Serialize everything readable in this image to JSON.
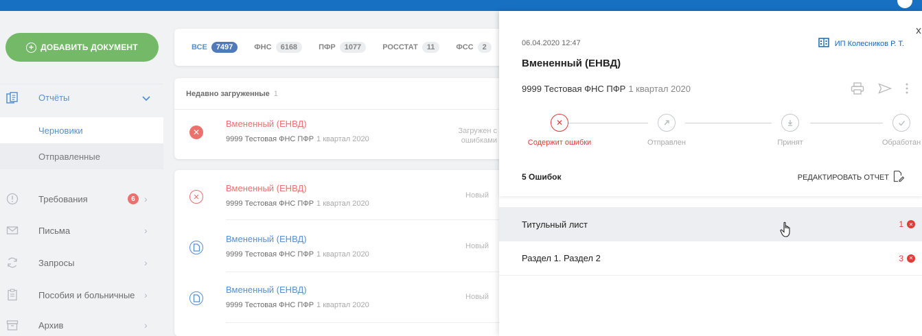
{
  "sidebar": {
    "add_button": "ДОБАВИТЬ ДОКУМЕНТ",
    "reports": "Отчёты",
    "drafts": "Черновики",
    "sent": "Отправленные",
    "items": [
      {
        "label": "Требования",
        "badge": "6",
        "icon": "alert-circle-icon"
      },
      {
        "label": "Письма",
        "icon": "envelope-icon"
      },
      {
        "label": "Запросы",
        "icon": "refresh-icon"
      },
      {
        "label": "Пособия и больничные",
        "icon": "clipboard-icon"
      },
      {
        "label": "Архив",
        "icon": "archive-icon"
      }
    ]
  },
  "filters": [
    {
      "label": "ВСЕ",
      "count": "7497",
      "active": true
    },
    {
      "label": "ФНС",
      "count": "6168"
    },
    {
      "label": "ПФР",
      "count": "1077"
    },
    {
      "label": "РОССТАТ",
      "count": "11"
    },
    {
      "label": "ФСС",
      "count": "2"
    }
  ],
  "recent": {
    "header": "Недавно загруженные",
    "count": "1",
    "doc": {
      "title": "Вмененный (ЕНВД)",
      "org": "9999 Тестовая ФНС ПФР",
      "period": "1 квартал 2020",
      "status_line1": "Загружен с",
      "status_line2": "ошибками"
    }
  },
  "docs": [
    {
      "title": "Вмененный (ЕНВД)",
      "org": "9999 Тестовая ФНС ПФР",
      "period": "1 квартал 2020",
      "status": "Новый"
    },
    {
      "title": "Вмененный (ЕНВД)",
      "org": "9999 Тестовая ФНС ПФР",
      "period": "1 квартал 2020",
      "status": "Новый"
    },
    {
      "title": "Вмененный (ЕНВД)",
      "org": "9999 Тестовая ФНС ПФР",
      "period": "1 квартал 2020",
      "status": "Новый"
    }
  ],
  "panel": {
    "date": "06.04.2020 12:47",
    "org": "ИП Колесников Р. Т.",
    "title": "Вмененный (ЕНВД)",
    "sub_org": "9999 Тестовая ФНС ПФР",
    "period": "1 квартал 2020",
    "steps": [
      "Содержит ошибки",
      "Отправлен",
      "Принят",
      "Обработан"
    ],
    "errors_label": "5 Ошибок",
    "edit_label": "РЕДАКТИРОВАТЬ ОТЧЕТ",
    "sections": [
      {
        "name": "Титульный лист",
        "errors": "1"
      },
      {
        "name": "Раздел 1. Раздел 2",
        "errors": "3"
      }
    ]
  },
  "colors": {
    "accent": "#1565c0",
    "brand_bar": "#1770c2",
    "add_button": "#3f9e2e",
    "error": "#e53935"
  }
}
